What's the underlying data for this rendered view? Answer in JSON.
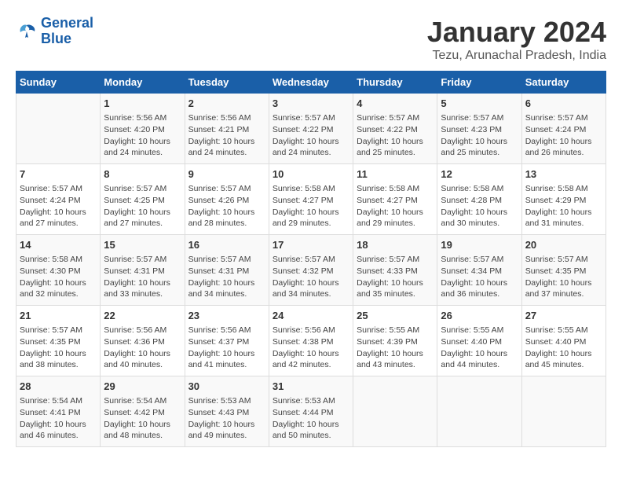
{
  "header": {
    "logo_line1": "General",
    "logo_line2": "Blue",
    "month": "January 2024",
    "location": "Tezu, Arunachal Pradesh, India"
  },
  "days_of_week": [
    "Sunday",
    "Monday",
    "Tuesday",
    "Wednesday",
    "Thursday",
    "Friday",
    "Saturday"
  ],
  "weeks": [
    [
      {
        "day": "",
        "info": ""
      },
      {
        "day": "1",
        "info": "Sunrise: 5:56 AM\nSunset: 4:20 PM\nDaylight: 10 hours\nand 24 minutes."
      },
      {
        "day": "2",
        "info": "Sunrise: 5:56 AM\nSunset: 4:21 PM\nDaylight: 10 hours\nand 24 minutes."
      },
      {
        "day": "3",
        "info": "Sunrise: 5:57 AM\nSunset: 4:22 PM\nDaylight: 10 hours\nand 24 minutes."
      },
      {
        "day": "4",
        "info": "Sunrise: 5:57 AM\nSunset: 4:22 PM\nDaylight: 10 hours\nand 25 minutes."
      },
      {
        "day": "5",
        "info": "Sunrise: 5:57 AM\nSunset: 4:23 PM\nDaylight: 10 hours\nand 25 minutes."
      },
      {
        "day": "6",
        "info": "Sunrise: 5:57 AM\nSunset: 4:24 PM\nDaylight: 10 hours\nand 26 minutes."
      }
    ],
    [
      {
        "day": "7",
        "info": "Sunrise: 5:57 AM\nSunset: 4:24 PM\nDaylight: 10 hours\nand 27 minutes."
      },
      {
        "day": "8",
        "info": "Sunrise: 5:57 AM\nSunset: 4:25 PM\nDaylight: 10 hours\nand 27 minutes."
      },
      {
        "day": "9",
        "info": "Sunrise: 5:57 AM\nSunset: 4:26 PM\nDaylight: 10 hours\nand 28 minutes."
      },
      {
        "day": "10",
        "info": "Sunrise: 5:58 AM\nSunset: 4:27 PM\nDaylight: 10 hours\nand 29 minutes."
      },
      {
        "day": "11",
        "info": "Sunrise: 5:58 AM\nSunset: 4:27 PM\nDaylight: 10 hours\nand 29 minutes."
      },
      {
        "day": "12",
        "info": "Sunrise: 5:58 AM\nSunset: 4:28 PM\nDaylight: 10 hours\nand 30 minutes."
      },
      {
        "day": "13",
        "info": "Sunrise: 5:58 AM\nSunset: 4:29 PM\nDaylight: 10 hours\nand 31 minutes."
      }
    ],
    [
      {
        "day": "14",
        "info": "Sunrise: 5:58 AM\nSunset: 4:30 PM\nDaylight: 10 hours\nand 32 minutes."
      },
      {
        "day": "15",
        "info": "Sunrise: 5:57 AM\nSunset: 4:31 PM\nDaylight: 10 hours\nand 33 minutes."
      },
      {
        "day": "16",
        "info": "Sunrise: 5:57 AM\nSunset: 4:31 PM\nDaylight: 10 hours\nand 34 minutes."
      },
      {
        "day": "17",
        "info": "Sunrise: 5:57 AM\nSunset: 4:32 PM\nDaylight: 10 hours\nand 34 minutes."
      },
      {
        "day": "18",
        "info": "Sunrise: 5:57 AM\nSunset: 4:33 PM\nDaylight: 10 hours\nand 35 minutes."
      },
      {
        "day": "19",
        "info": "Sunrise: 5:57 AM\nSunset: 4:34 PM\nDaylight: 10 hours\nand 36 minutes."
      },
      {
        "day": "20",
        "info": "Sunrise: 5:57 AM\nSunset: 4:35 PM\nDaylight: 10 hours\nand 37 minutes."
      }
    ],
    [
      {
        "day": "21",
        "info": "Sunrise: 5:57 AM\nSunset: 4:35 PM\nDaylight: 10 hours\nand 38 minutes."
      },
      {
        "day": "22",
        "info": "Sunrise: 5:56 AM\nSunset: 4:36 PM\nDaylight: 10 hours\nand 40 minutes."
      },
      {
        "day": "23",
        "info": "Sunrise: 5:56 AM\nSunset: 4:37 PM\nDaylight: 10 hours\nand 41 minutes."
      },
      {
        "day": "24",
        "info": "Sunrise: 5:56 AM\nSunset: 4:38 PM\nDaylight: 10 hours\nand 42 minutes."
      },
      {
        "day": "25",
        "info": "Sunrise: 5:55 AM\nSunset: 4:39 PM\nDaylight: 10 hours\nand 43 minutes."
      },
      {
        "day": "26",
        "info": "Sunrise: 5:55 AM\nSunset: 4:40 PM\nDaylight: 10 hours\nand 44 minutes."
      },
      {
        "day": "27",
        "info": "Sunrise: 5:55 AM\nSunset: 4:40 PM\nDaylight: 10 hours\nand 45 minutes."
      }
    ],
    [
      {
        "day": "28",
        "info": "Sunrise: 5:54 AM\nSunset: 4:41 PM\nDaylight: 10 hours\nand 46 minutes."
      },
      {
        "day": "29",
        "info": "Sunrise: 5:54 AM\nSunset: 4:42 PM\nDaylight: 10 hours\nand 48 minutes."
      },
      {
        "day": "30",
        "info": "Sunrise: 5:53 AM\nSunset: 4:43 PM\nDaylight: 10 hours\nand 49 minutes."
      },
      {
        "day": "31",
        "info": "Sunrise: 5:53 AM\nSunset: 4:44 PM\nDaylight: 10 hours\nand 50 minutes."
      },
      {
        "day": "",
        "info": ""
      },
      {
        "day": "",
        "info": ""
      },
      {
        "day": "",
        "info": ""
      }
    ]
  ]
}
